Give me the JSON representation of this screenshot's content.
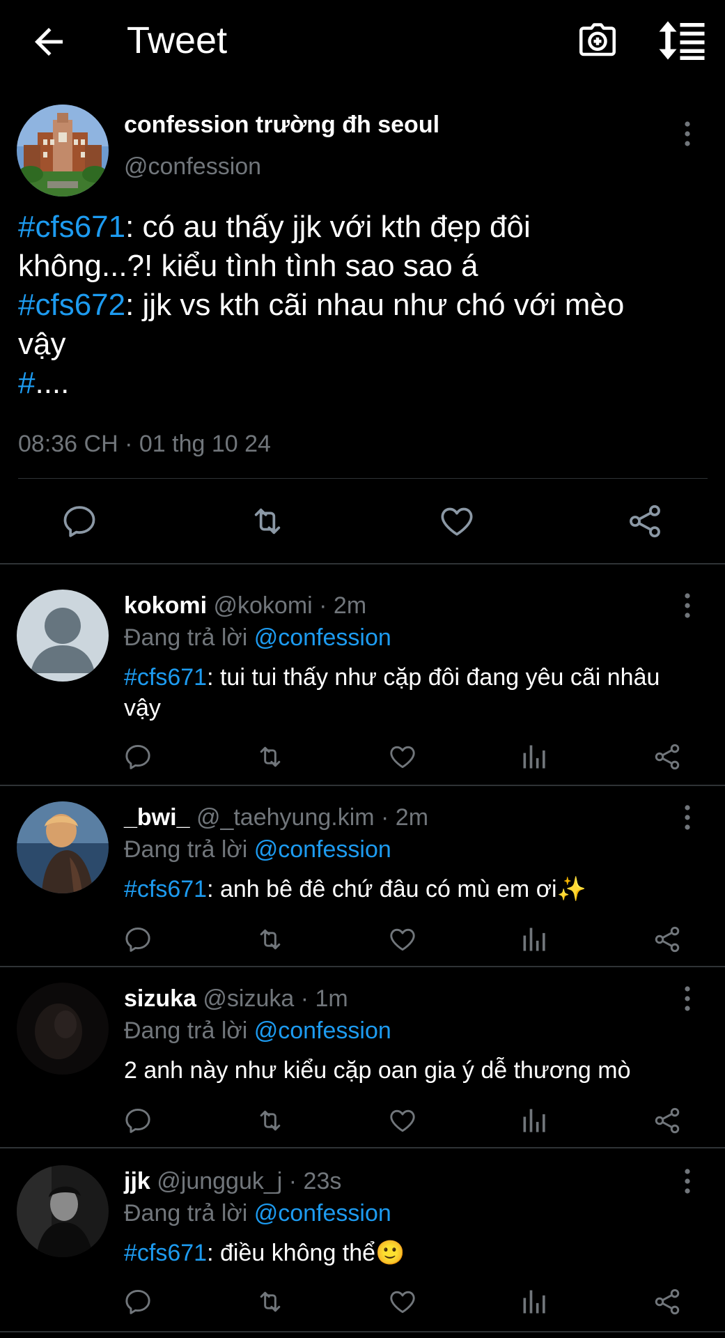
{
  "header": {
    "title": "Tweet",
    "back_icon": "arrow-left-icon",
    "camera_icon": "camera-plus-icon",
    "sort_icon": "sort-icon"
  },
  "tweet": {
    "author_name": "confession trường đh seoul",
    "author_handle": "@confession",
    "lines": [
      {
        "tag": "#cfs671",
        "text": ": có au thấy jjk với kth đẹp đôi"
      },
      {
        "tag": "",
        "text": "không...?! kiểu tình tình sao sao á"
      },
      {
        "tag": "#cfs672",
        "text": ": jjk vs kth cãi nhau như chó với mèo"
      },
      {
        "tag": "",
        "text": "vậy"
      },
      {
        "tag": "#",
        "text": "...."
      }
    ],
    "timestamp": "08:36 CH · 01 thg 10 24"
  },
  "replies": [
    {
      "name": "kokomi",
      "meta": "@kokomi · 2m",
      "replying_label": "Đang trả lời",
      "replying_to": "@confession",
      "tag": "#cfs671",
      "text": ": tui tui thấy như cặp đôi đang yêu cãi nhâu vậy"
    },
    {
      "name": "_bwi_",
      "meta": "@_taehyung.kim · 2m",
      "replying_label": "Đang trả lời",
      "replying_to": "@confession",
      "tag": "#cfs671",
      "text": ": anh bê đê chứ đâu có mù em ơi✨"
    },
    {
      "name": "sizuka",
      "meta": "@sizuka · 1m",
      "replying_label": "Đang trả lời",
      "replying_to": "@confession",
      "tag": "",
      "text": "2 anh này như kiểu cặp oan gia ý dễ thương mò"
    },
    {
      "name": "jjk",
      "meta": "@jungguk_j · 23s",
      "replying_label": "Đang trả lời",
      "replying_to": "@confession",
      "tag": "#cfs671",
      "text": ": điều không thể🙂"
    }
  ],
  "colors": {
    "background": "#000000",
    "accent": "#1d9bf0",
    "muted": "#71767b",
    "divider": "#2f3336"
  }
}
